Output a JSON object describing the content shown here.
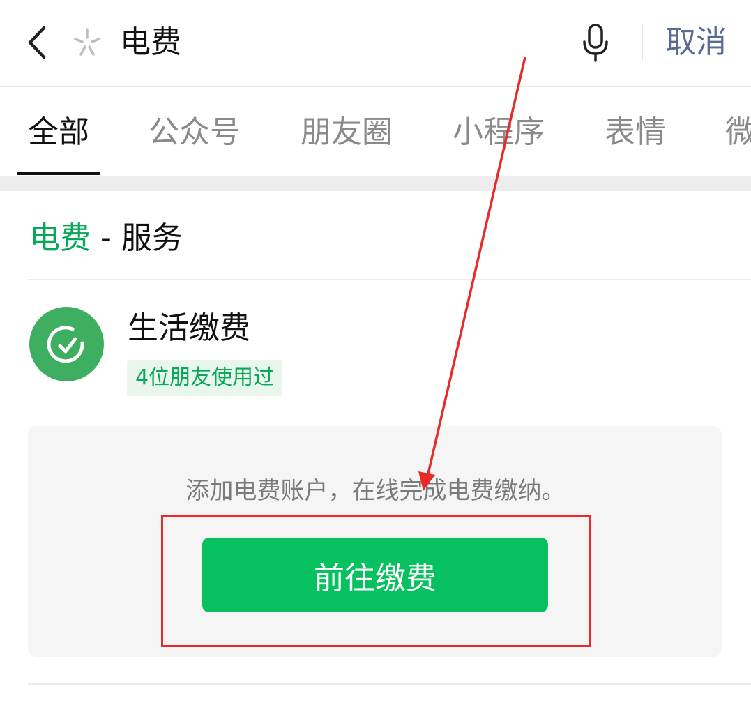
{
  "search": {
    "query": "电费",
    "cancel_label": "取消"
  },
  "tabs": [
    {
      "label": "全部",
      "active": true
    },
    {
      "label": "公众号",
      "active": false
    },
    {
      "label": "朋友圈",
      "active": false
    },
    {
      "label": "小程序",
      "active": false
    },
    {
      "label": "表情",
      "active": false
    },
    {
      "label": "微",
      "active": false
    }
  ],
  "section": {
    "keyword": "电费",
    "separator": " - ",
    "title": "服务"
  },
  "service": {
    "name": "生活缴费",
    "friends_badge": "4位朋友使用过",
    "logo_icon": "check-drop-icon",
    "logo_color": "#3eaf60"
  },
  "card": {
    "description": "添加电费账户，在线完成电费缴纳。",
    "button_label": "前往缴费",
    "button_color": "#07c160"
  },
  "colors": {
    "accent_green": "#07a857",
    "link_blue": "#576b95",
    "annotation_red": "#e82a2a"
  }
}
